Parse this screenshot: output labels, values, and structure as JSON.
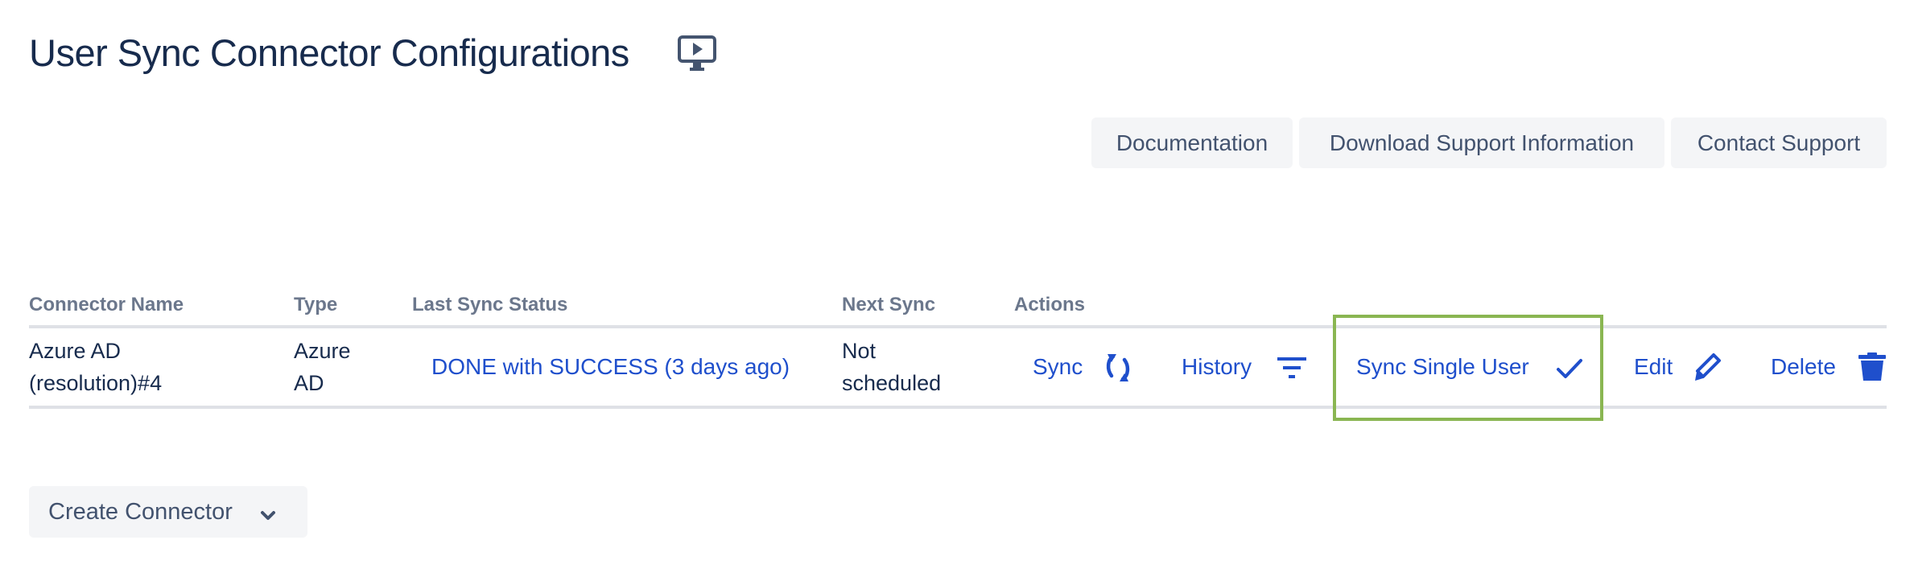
{
  "header": {
    "title": "User Sync Connector Configurations",
    "title_icon": "monitor-play-icon"
  },
  "toolbar": {
    "buttons": [
      {
        "label": "Documentation"
      },
      {
        "label": "Download Support Information"
      },
      {
        "label": "Contact Support"
      }
    ]
  },
  "table": {
    "columns": [
      "Connector Name",
      "Type",
      "Last Sync Status",
      "Next Sync",
      "Actions"
    ],
    "rows": [
      {
        "connector_name": [
          "Azure AD",
          "(resolution)#4"
        ],
        "type": [
          "Azure",
          "AD"
        ],
        "last_sync_status": "DONE with SUCCESS (3 days ago)",
        "next_sync": [
          "Not",
          "scheduled"
        ],
        "actions": [
          {
            "label": "Sync",
            "icon": "sync-icon"
          },
          {
            "label": "History",
            "icon": "filter-icon"
          },
          {
            "label": "Sync Single User",
            "icon": "check-icon",
            "highlighted": true
          },
          {
            "label": "Edit",
            "icon": "pencil-icon"
          },
          {
            "label": "Delete",
            "icon": "trash-icon"
          }
        ]
      }
    ]
  },
  "footer": {
    "create_button_label": "Create Connector",
    "create_button_icon": "chevron-down-icon"
  },
  "colors": {
    "link": "#1f4fcc",
    "highlight": "#8ab652",
    "title": "#172b4d",
    "button_bg": "#f4f5f7"
  }
}
